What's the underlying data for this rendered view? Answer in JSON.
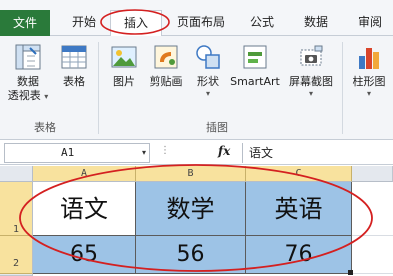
{
  "tabs": {
    "file": "文件",
    "home": "开始",
    "insert": "插入",
    "page_layout": "页面布局",
    "formulas": "公式",
    "data": "数据",
    "review": "审阅"
  },
  "ribbon": {
    "pivot_label_1": "数据",
    "pivot_label_2": "透视表",
    "table_label": "表格",
    "picture_label": "图片",
    "clipart_label": "剪贴画",
    "shapes_label": "形状",
    "smartart_label": "SmartArt",
    "screenshot_label": "屏幕截图",
    "chart_label": "柱形图",
    "group_tables": "表格",
    "group_illustrations": "插图"
  },
  "formula_bar": {
    "cell_ref": "A1",
    "fx_label": "fx",
    "content": "语文"
  },
  "sheet": {
    "columns": [
      "A",
      "B",
      "C"
    ],
    "rows": [
      "1",
      "2"
    ],
    "header_row": [
      "语文",
      "数学",
      "英语"
    ],
    "value_row": [
      "65",
      "56",
      "76"
    ]
  },
  "colors": {
    "file_tab": "#2a7a3a",
    "selected_header": "#f8e29e",
    "cell_highlight": "#9dc3e6",
    "annotation": "#d42020"
  }
}
